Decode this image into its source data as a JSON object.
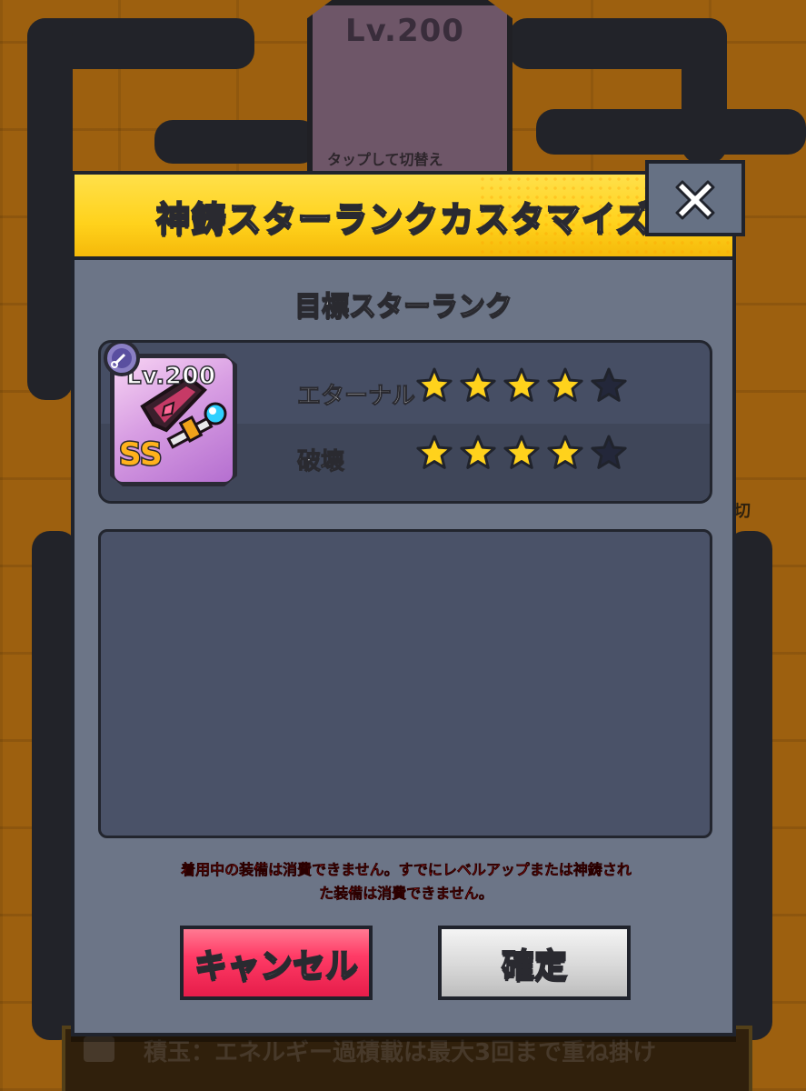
{
  "background": {
    "equip_level": "Lv.200",
    "equip_hint": "タップして切替え",
    "bottom_bar_text": "積玉：エネルギー過積載は最大3回まで重ね掛け",
    "right_fragment": "切"
  },
  "dialog": {
    "title": "神鋳スターランクカスタマイズ",
    "close_icon": "close-icon",
    "section_title": "目標スターランク",
    "equipment": {
      "level": "Lv.200",
      "rank_badge": "SS",
      "element_icon": "dark-element-icon",
      "item_icon": "sword-icon"
    },
    "ranks": [
      {
        "label": "エターナル",
        "filled": 4,
        "total": 5
      },
      {
        "label": "破壊",
        "filled": 4,
        "total": 5
      }
    ],
    "warning": "着用中の装備は消費できません。すでにレベルアップまたは神鋳された装備は消費できません。",
    "buttons": {
      "cancel_label": "キャンセル",
      "confirm_label": "確定"
    }
  },
  "colors": {
    "header_yellow": "#ffd21c",
    "panel_bg": "#6c7587",
    "cancel_red": "#ff3b66",
    "confirm_gray": "#d8d8d8",
    "star_filled": "#ffd21c",
    "star_empty": "#23273a",
    "warning_red": "#ff2020"
  }
}
